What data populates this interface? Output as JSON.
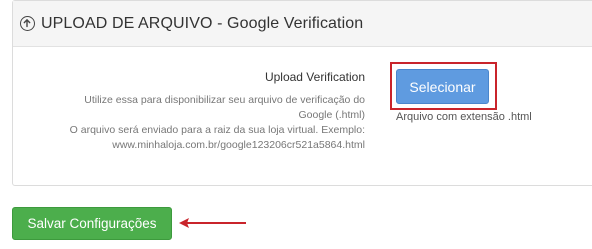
{
  "panel": {
    "title": "UPLOAD DE ARQUIVO - Google Verification",
    "icon": "upload-circle-icon"
  },
  "field": {
    "label": "Upload Verification",
    "help_lines": [
      "Utilize essa para disponibilizar seu arquivo de verificação do",
      "Google (.html)",
      "O arquivo será enviado para a raiz da sua loja virtual. Exemplo:",
      "www.minhaloja.com.br/google123206cr521a5864.html"
    ]
  },
  "select": {
    "label": "Selecionar",
    "hint": "Arquivo com extensão .html"
  },
  "save": {
    "label": "Salvar Configurações"
  },
  "colors": {
    "select_button": "#5f9be0",
    "save_button": "#4cae4c",
    "highlight": "#c9242b"
  }
}
